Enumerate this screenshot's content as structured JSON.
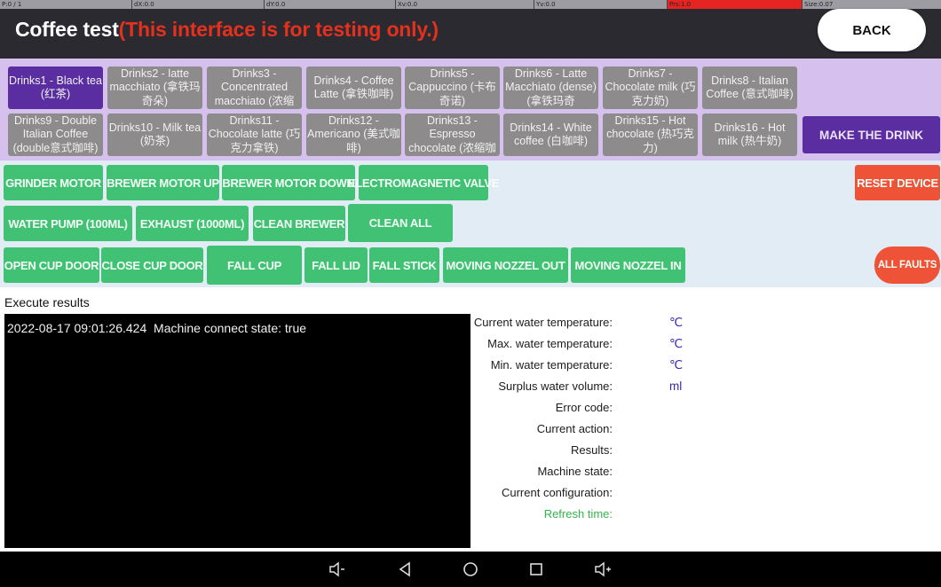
{
  "debug_bar": {
    "p": "P:0 / 1",
    "dx": "dX:0.0",
    "dy": "dY:0.0",
    "xv": "Xv:0.0",
    "yv": "Yv:0.0",
    "prs": "Prs:1.0",
    "size": "Size:0.07"
  },
  "header": {
    "title": "Coffee test",
    "warning": "(This interface is for testing only.)",
    "back_label": "BACK"
  },
  "drinks": {
    "selected_index": 0,
    "items": [
      "Drinks1 - Black tea (红茶)",
      "Drinks2 - latte macchiato (拿铁玛奇朵)",
      "Drinks3 - Concentrated macchiato (浓缩",
      "Drinks4 - Coffee Latte (拿铁咖啡)",
      "Drinks5 - Cappuccino (卡布奇诺)",
      "Drinks6 - Latte Macchiato (dense) (拿铁玛奇",
      "Drinks7 - Chocolate milk (巧克力奶)",
      "Drinks8 - Italian Coffee (意式咖啡)",
      "Drinks9 - Double Italian Coffee (double意式咖啡)",
      "Drinks10 - Milk tea (奶茶)",
      "Drinks11 - Chocolate latte (巧克力拿铁)",
      "Drinks12 - Americano (美式咖啡)",
      "Drinks13 - Espresso chocolate (浓缩咖",
      "Drinks14 - White coffee (白咖啡)",
      "Drinks15 - Hot chocolate (热巧克力)",
      "Drinks16 - Hot milk (热牛奶)"
    ],
    "make_label": "MAKE THE DRINK"
  },
  "controls": {
    "row1": [
      "GRINDER MOTOR",
      "BREWER MOTOR UP",
      "BREWER MOTOR DOWN",
      "ELECTROMAGNETIC VALVE"
    ],
    "row2": [
      "WATER PUMP (100ML)",
      "EXHAUST (1000ML)",
      "CLEAN BREWER",
      "CLEAN ALL"
    ],
    "row3": [
      "OPEN CUP DOOR",
      "CLOSE CUP DOOR",
      "FALL CUP",
      "FALL LID",
      "FALL STICK",
      "MOVING NOZZEL OUT",
      "MOVING NOZZEL IN"
    ],
    "reset_label": "RESET DEVICE",
    "faults_label": "ALL FAULTS"
  },
  "results": {
    "label": "Execute results",
    "log": "2022-08-17 09:01:26.424  Machine connect state: true"
  },
  "status": [
    {
      "label": "Current water temperature:",
      "unit": "℃"
    },
    {
      "label": "Max. water temperature:",
      "unit": "℃"
    },
    {
      "label": "Min. water temperature:",
      "unit": "℃"
    },
    {
      "label": "Surplus water volume:",
      "unit": "ml"
    },
    {
      "label": "Error code:",
      "unit": ""
    },
    {
      "label": "Current action:",
      "unit": ""
    },
    {
      "label": "Results:",
      "unit": ""
    },
    {
      "label": "Machine state:",
      "unit": ""
    },
    {
      "label": "Current configuration:",
      "unit": ""
    },
    {
      "label": "Refresh time:",
      "unit": ""
    }
  ],
  "colors": {
    "accent_purple": "#5a2ea0",
    "action_green": "#41c173",
    "danger_red": "#ef5337",
    "warning_text": "#e3311e"
  }
}
